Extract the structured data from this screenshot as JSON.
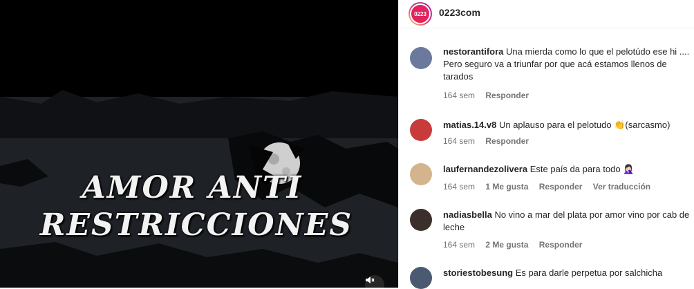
{
  "post": {
    "overlay_line1": "AMOR ANTI",
    "overlay_line2": "RESTRICCIONES",
    "mute_icon": "speaker-muted-icon"
  },
  "header": {
    "logo_text": "0223",
    "account": "0223com"
  },
  "comments": [
    {
      "user": "nestorantifora",
      "text": "Una mierda como lo que el pelotúdo ese hi .... Pero seguro va a triunfar por que acá estamos llenos de tarados",
      "time": "164 sem",
      "likes": "",
      "reply": "Responder",
      "translate": ""
    },
    {
      "user": "matias.14.v8",
      "text": "Un aplauso para el pelotudo 👏(sarcasmo)",
      "time": "164 sem",
      "likes": "",
      "reply": "Responder",
      "translate": ""
    },
    {
      "user": "laufernandezolivera",
      "text": "Este país da para todo 🤦🏻‍♀️",
      "time": "164 sem",
      "likes": "1 Me gusta",
      "reply": "Responder",
      "translate": "Ver traducción"
    },
    {
      "user": "nadiasbella",
      "text": "No vino a mar del plata por amor vino por cab de leche",
      "time": "164 sem",
      "likes": "2 Me gusta",
      "reply": "Responder",
      "translate": ""
    },
    {
      "user": "storiestobesung",
      "text": "Es para darle perpetua por salchicha",
      "time": "",
      "likes": "",
      "reply": "",
      "translate": ""
    }
  ],
  "colors": {
    "accent": "#e0245e",
    "text": "#262626",
    "meta": "#737373"
  }
}
